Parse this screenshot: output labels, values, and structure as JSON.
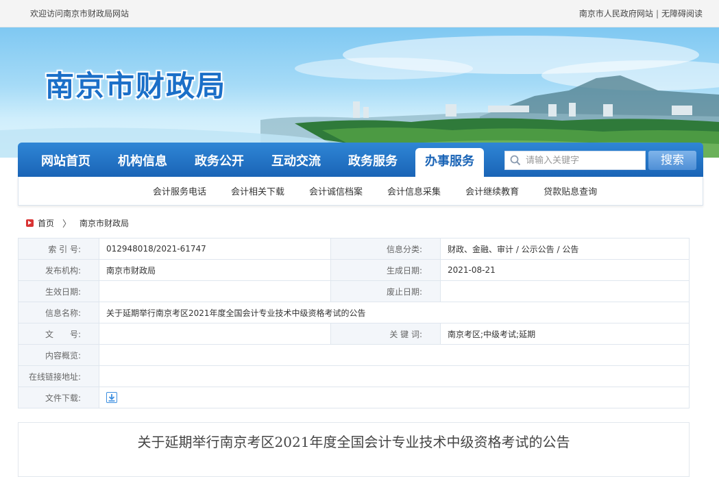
{
  "topbar": {
    "welcome": "欢迎访问南京市财政局网站",
    "gov_link": "南京市人民政府网站",
    "separator": "|",
    "accessible": "无障碍阅读"
  },
  "banner": {
    "site_title": "南京市财政局"
  },
  "mainnav": {
    "items": [
      "网站首页",
      "机构信息",
      "政务公开",
      "互动交流",
      "政务服务",
      "办事服务"
    ],
    "active_index": 5
  },
  "search": {
    "placeholder": "请输入关键字",
    "button": "搜索"
  },
  "subnav": {
    "items": [
      "会计服务电话",
      "会计相关下载",
      "会计诚信档案",
      "会计信息采集",
      "会计继续教育",
      "贷款贴息查询"
    ]
  },
  "breadcrumb": {
    "home": "首页",
    "arrow": "〉",
    "current": "南京市财政局"
  },
  "info": {
    "index_label": "索 引 号:",
    "index_value": "012948018/2021-61747",
    "category_label": "信息分类:",
    "category_value": "财政、金融、审计 / 公示公告 / 公告",
    "publisher_label": "发布机构:",
    "publisher_value": "南京市财政局",
    "created_label": "生成日期:",
    "created_value": "2021-08-21",
    "effective_label": "生效日期:",
    "effective_value": "",
    "expire_label": "废止日期:",
    "expire_value": "",
    "name_label": "信息名称:",
    "name_value": "关于延期举行南京考区2021年度全国会计专业技术中级资格考试的公告",
    "docno_label": "文　　号:",
    "docno_value": "",
    "keywords_label": "关 键 词:",
    "keywords_value": "南京考区;中级考试;延期",
    "summary_label": "内容概览:",
    "summary_value": "",
    "link_label": "在线链接地址:",
    "link_value": "",
    "download_label": "文件下载:"
  },
  "article": {
    "title": "关于延期举行南京考区2021年度全国会计专业技术中级资格考试的公告"
  },
  "colors": {
    "nav_blue": "#1a64b6",
    "title_blue": "#1b6fc8",
    "crumb_red": "#d93434"
  }
}
